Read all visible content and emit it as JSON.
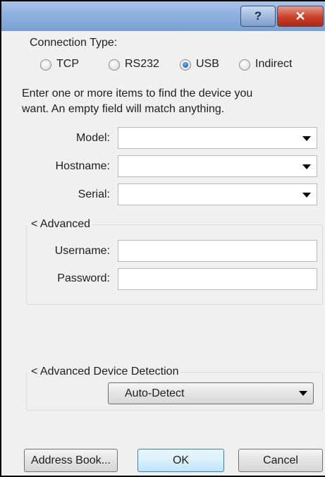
{
  "titlebar": {
    "help_glyph": "?",
    "close_glyph": "✕"
  },
  "connection": {
    "label": "Connection Type:",
    "options": [
      {
        "label": "TCP",
        "checked": false
      },
      {
        "label": "RS232",
        "checked": false
      },
      {
        "label": "USB",
        "checked": true
      },
      {
        "label": "Indirect",
        "checked": false
      }
    ]
  },
  "instructions": {
    "line1": "Enter one or more items to find the device you",
    "line2": "want.  An empty field will match anything."
  },
  "fields": {
    "model": {
      "label": "Model:",
      "value": ""
    },
    "hostname": {
      "label": "Hostname:",
      "value": ""
    },
    "serial": {
      "label": "Serial:",
      "value": ""
    }
  },
  "advanced": {
    "legend": "< Advanced",
    "username": {
      "label": "Username:",
      "value": ""
    },
    "password": {
      "label": "Password:",
      "value": ""
    }
  },
  "detection": {
    "legend": "< Advanced Device Detection",
    "selected": "Auto-Detect"
  },
  "buttons": {
    "address_book": "Address Book...",
    "ok": "OK",
    "cancel": "Cancel"
  }
}
